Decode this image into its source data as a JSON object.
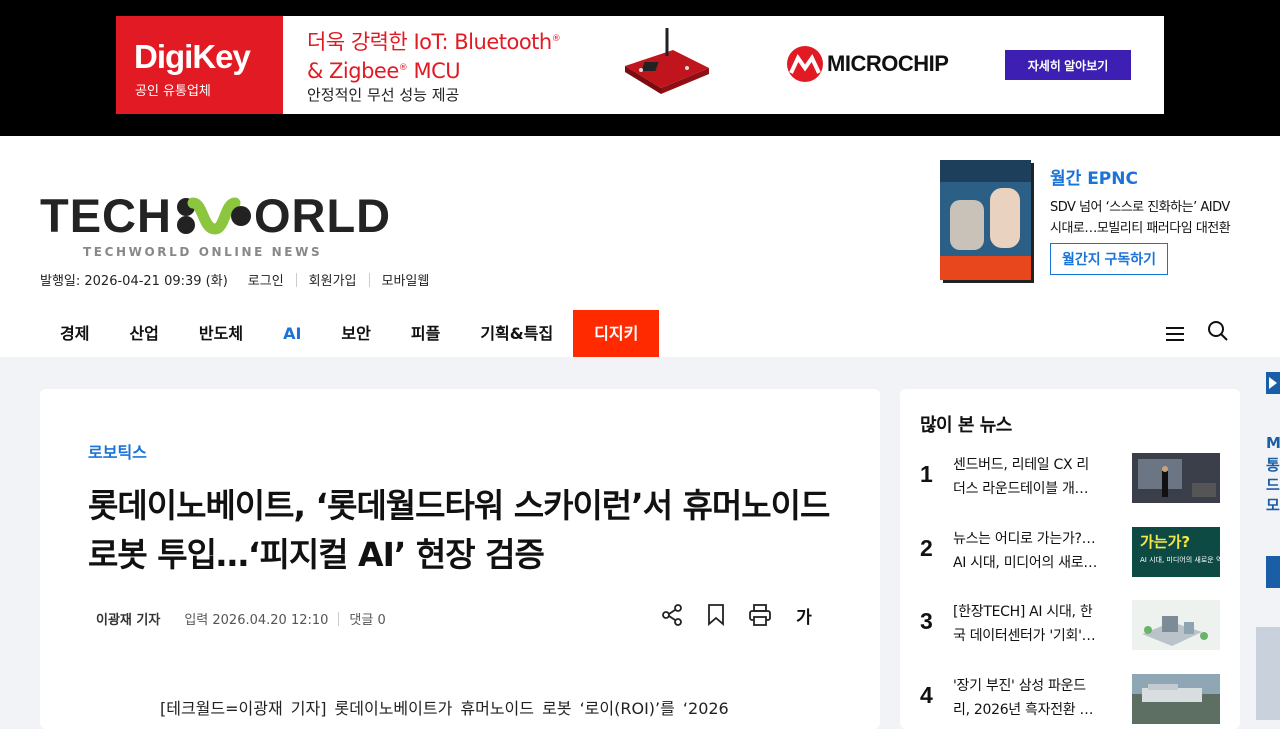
{
  "ad": {
    "brand": "DigiKey",
    "brand_sub": "공인 유통업체",
    "headline_1": "더욱 강력한 IoT: Bluetooth",
    "headline_2": "& Zigbee",
    "headline_3": " MCU",
    "reg": "®",
    "desc": "안정적인 무선 성능 제공",
    "partner": "MICROCHIP",
    "cta": "자세히 알아보기",
    "colors": {
      "red": "#e21a23",
      "button": "#3d1fb3"
    }
  },
  "site": {
    "logo_left": "TECH",
    "logo_right": "ORLD",
    "tagline": "TECHWORLD ONLINE NEWS",
    "publish": "발행일: 2026-04-21 09:39 (화)",
    "login": "로그인",
    "signup": "회원가입",
    "mobile": "모바일웹"
  },
  "magazine": {
    "title": "월간 EPNC",
    "line1": "SDV 넘어 ‘스스로 진화하는’ AIDV",
    "line2": "시대로…모빌리티 패러다임 대전환",
    "subscribe": "월간지 구독하기"
  },
  "nav": {
    "items": [
      "경제",
      "산업",
      "반도체",
      "AI",
      "보안",
      "피플",
      "기획&특집",
      "디지키"
    ],
    "menu_icon": "hamburger-icon",
    "search_icon": "search-icon",
    "accent": "#1a73d9",
    "highlight": "#ff2a00"
  },
  "article": {
    "category": "로보틱스",
    "title": "롯데이노베이트, ‘롯데월드타워 스카이런’서 휴머노이드 로봇 투입…‘피지컬 AI’ 현장 검증",
    "author": "이광재 기자",
    "date": "입력 2026.04.20 12:10",
    "comments": "댓글 0",
    "font_tool": "가",
    "body_start": "[테크월드=이광재 기자] 롯데이노베이트가 휴머노이드 로봇 ‘로이(ROI)’를 ‘2026"
  },
  "popular": {
    "title": "많이 본 뉴스",
    "items": [
      {
        "rank": "1",
        "line1": "센드버드, 리테일 CX 리",
        "line2": "더스 라운드테이블 개…"
      },
      {
        "rank": "2",
        "line1": "뉴스는 어디로 가는가?…",
        "line2": "AI 시대, 미디어의 새로…"
      },
      {
        "rank": "3",
        "line1": "[한장TECH] AI 시대, 한",
        "line2": "국 데이터센터가 '기회'…"
      },
      {
        "rank": "4",
        "line1": "'장기 부진' 삼성 파운드",
        "line2": "리, 2026년 흑자전환 …"
      }
    ],
    "thumb2_text": "가는가?",
    "thumb2_sub": "AI 시대, 미디어의 새로운 역할"
  },
  "edge": {
    "letters": [
      "M",
      "통",
      "드",
      "모"
    ]
  }
}
